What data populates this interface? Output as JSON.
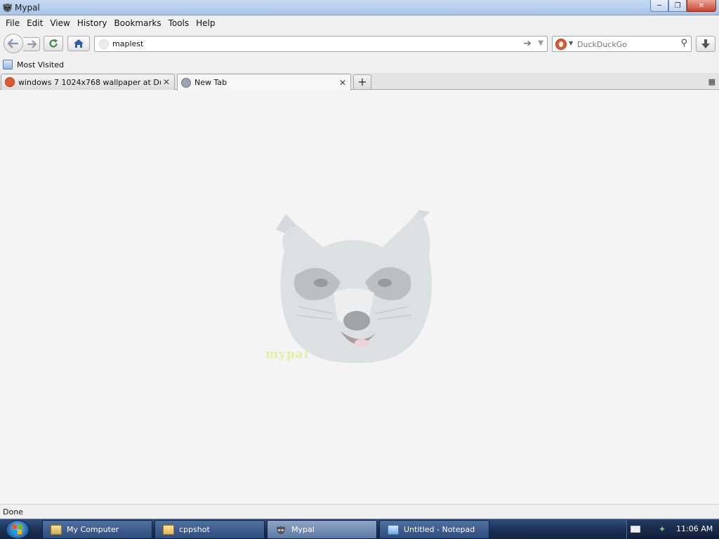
{
  "window": {
    "title": "Mypal"
  },
  "menu": [
    "File",
    "Edit",
    "View",
    "History",
    "Bookmarks",
    "Tools",
    "Help"
  ],
  "navigation": {
    "url": "maplest",
    "search_placeholder": "DuckDuckGo"
  },
  "bookmarks": {
    "most_visited": "Most Visited"
  },
  "tabs": [
    {
      "label": "windows 7 1024x768 wallpaper at Duc...",
      "active": false
    },
    {
      "label": "New Tab",
      "active": true
    }
  ],
  "content": {
    "watermark": "mypal"
  },
  "status": {
    "text": "Done"
  },
  "taskbar": {
    "items": [
      {
        "label": "My Computer",
        "active": false
      },
      {
        "label": "cppshot",
        "active": false
      },
      {
        "label": "Mypal",
        "active": true
      },
      {
        "label": "Untitled - Notepad",
        "active": false
      }
    ],
    "clock": "11:06 AM"
  },
  "colors": {
    "duckduckgo": "#de5833",
    "taskbar": "#1a2f53",
    "titlebar": "#b7cfee"
  }
}
